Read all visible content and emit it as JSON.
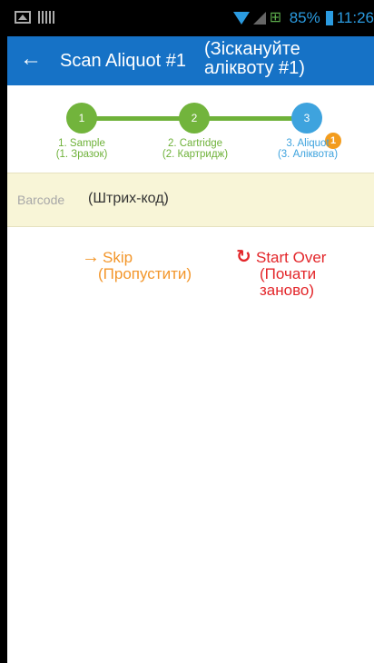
{
  "status_bar": {
    "battery": "85%",
    "time": "11:26",
    "wifi_icon": "wifi-icon",
    "signal_icon": "signal-icon",
    "network_icon": "network-icon",
    "gallery_icon": "image-icon",
    "barcode_icon": "barcode-status-icon"
  },
  "app_bar": {
    "back_icon": "arrow-left-icon",
    "title": "Scan Aliquot #1",
    "title_translation": "(Зіскануйте аліквоту #1)"
  },
  "stepper": {
    "steps": [
      {
        "number": "1",
        "label": "1. Sample",
        "translation": "(1. Зразок)",
        "state": "completed"
      },
      {
        "number": "2",
        "label": "2. Cartridge",
        "translation": "(2. Картридж)",
        "state": "completed"
      },
      {
        "number": "3",
        "label": "3. Aliquot",
        "translation": "(3. Аліквота)",
        "state": "active"
      }
    ],
    "badge": "1",
    "colors": {
      "completed": "#72b43c",
      "active": "#3ea3de",
      "badge": "#f39c1d"
    }
  },
  "barcode": {
    "placeholder": "Barcode",
    "translation": "(Штрих-код)"
  },
  "actions": {
    "skip": {
      "icon": "arrow-right-icon",
      "label": "Skip",
      "translation": "(Пропустити)",
      "color": "#f3962a"
    },
    "start_over": {
      "icon": "refresh-icon",
      "label": "Start Over",
      "translation": "(Почати заново)",
      "color": "#e3262a"
    }
  },
  "colors": {
    "app_bar": "#1672c6",
    "barcode_bg": "#f8f5d7"
  }
}
